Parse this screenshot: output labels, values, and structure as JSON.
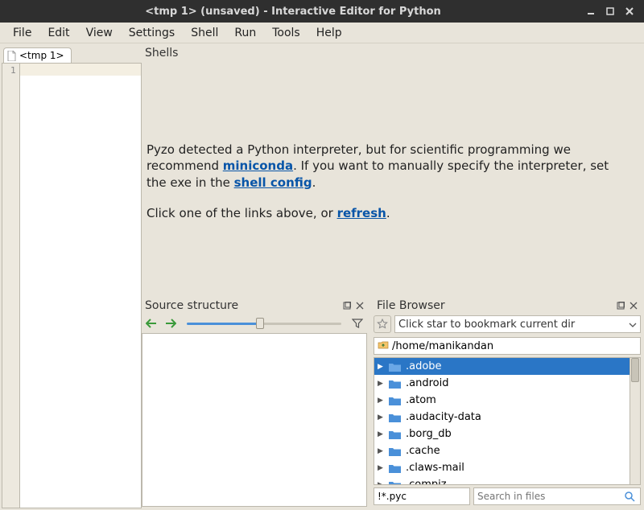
{
  "window": {
    "title": "<tmp 1> (unsaved) - Interactive Editor for Python"
  },
  "menu": [
    "File",
    "Edit",
    "View",
    "Settings",
    "Shell",
    "Run",
    "Tools",
    "Help"
  ],
  "editor": {
    "tab_label": "<tmp 1>",
    "line_number": "1"
  },
  "shells": {
    "title": "Shells",
    "msg_pre_miniconda": "Pyzo detected a Python interpreter, but for scientific programming we recommend ",
    "link_miniconda": "miniconda",
    "msg_post_miniconda": ". If you want to manually specify the interpreter, set the exe in the ",
    "link_shellconfig": "shell config",
    "msg_end1": ".",
    "msg_pre_refresh": "Click one of the links above, or ",
    "link_refresh": "refresh",
    "msg_end2": "."
  },
  "source": {
    "title": "Source structure"
  },
  "filebrowser": {
    "title": "File Browser",
    "bookmark_placeholder": "Click star to bookmark current dir",
    "path": "/home/manikandan",
    "items": [
      {
        "name": ".adobe",
        "selected": true
      },
      {
        "name": ".android"
      },
      {
        "name": ".atom"
      },
      {
        "name": ".audacity-data"
      },
      {
        "name": ".borg_db"
      },
      {
        "name": ".cache"
      },
      {
        "name": ".claws-mail"
      },
      {
        "name": ".compiz"
      }
    ],
    "filter_value": "!*.pyc",
    "search_placeholder": "Search in files"
  }
}
